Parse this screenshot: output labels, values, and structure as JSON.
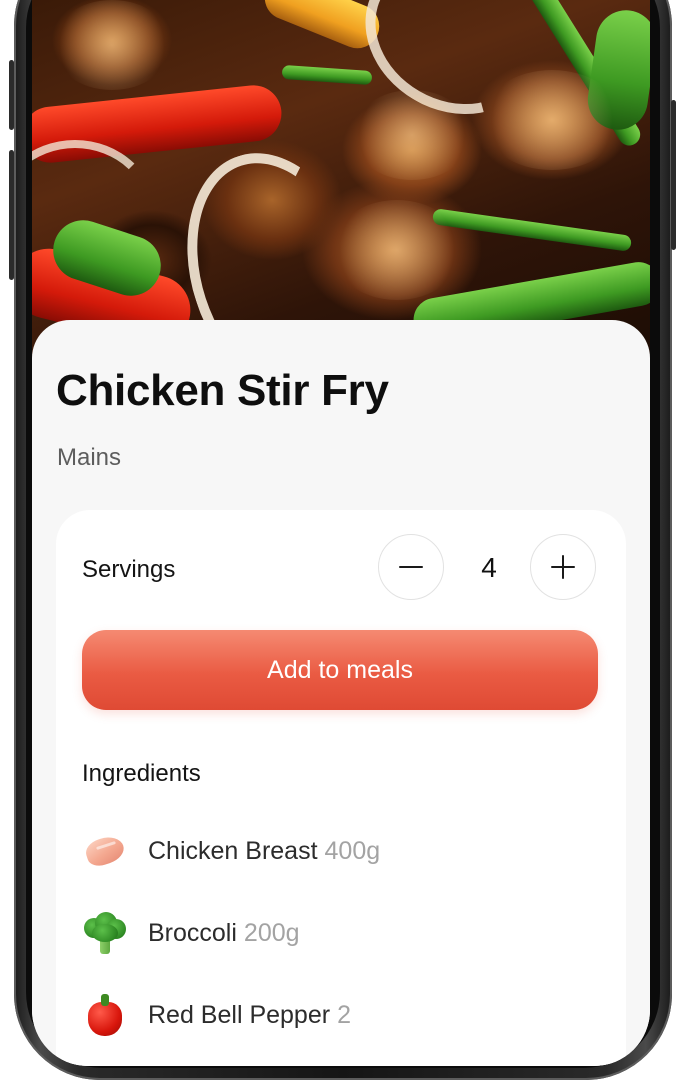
{
  "recipe": {
    "title": "Chicken Stir Fry",
    "category": "Mains",
    "image_icon": "stir-fry-photo"
  },
  "servings": {
    "label": "Servings",
    "value": "4",
    "decrement_icon": "minus-icon",
    "increment_icon": "plus-icon"
  },
  "actions": {
    "add_to_meals": "Add to meals"
  },
  "ingredients": {
    "heading": "Ingredients",
    "items": [
      {
        "icon": "chicken-breast-icon",
        "name": "Chicken Breast",
        "quantity": "400g"
      },
      {
        "icon": "broccoli-icon",
        "name": "Broccoli",
        "quantity": "200g"
      },
      {
        "icon": "red-bell-pepper-icon",
        "name": "Red Bell Pepper",
        "quantity": "2"
      }
    ]
  },
  "colors": {
    "accent": "#EA5B43",
    "accent_light": "#F58A72",
    "background": "#F7F7F7",
    "panel": "#FFFFFF",
    "muted_text": "#A3A3A3"
  }
}
